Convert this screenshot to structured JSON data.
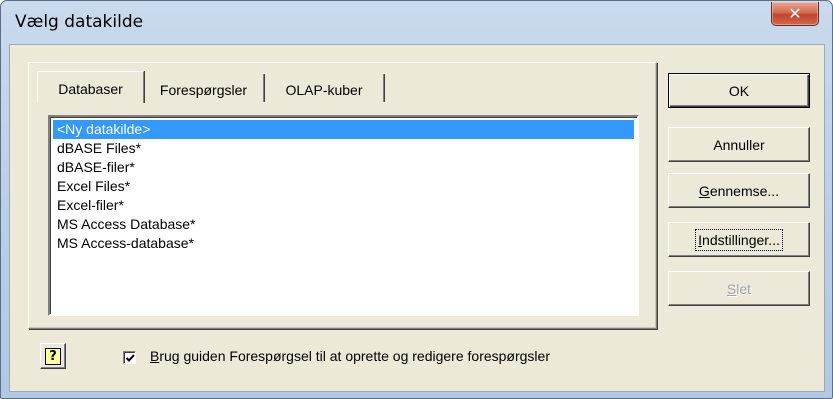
{
  "window": {
    "title": "Vælg datakilde"
  },
  "tabs": [
    {
      "label": "Databaser",
      "active": true
    },
    {
      "label": "Forespørgsler",
      "active": false
    },
    {
      "label": "OLAP-kuber",
      "active": false
    }
  ],
  "datasources": [
    "<Ny datakilde>",
    "dBASE Files*",
    "dBASE-filer*",
    "Excel Files*",
    "Excel-filer*",
    "MS Access Database*",
    "MS Access-database*"
  ],
  "selected_index": 0,
  "buttons": {
    "ok": "OK",
    "cancel": "Annuller",
    "browse_accel": "G",
    "browse_rest": "ennemse...",
    "options_accel": "I",
    "options_rest": "ndstillinger...",
    "delete_accel": "S",
    "delete_rest": "let"
  },
  "help": {
    "glyph": "?"
  },
  "wizard_option": {
    "checked": true,
    "label_accel": "B",
    "label_rest": "rug guiden Forespørgsel til at oprette og redigere forespørgsler"
  },
  "colors": {
    "selection": "#3399ff",
    "dialog_face": "#ece9d8",
    "close_button": "#c0452b"
  }
}
